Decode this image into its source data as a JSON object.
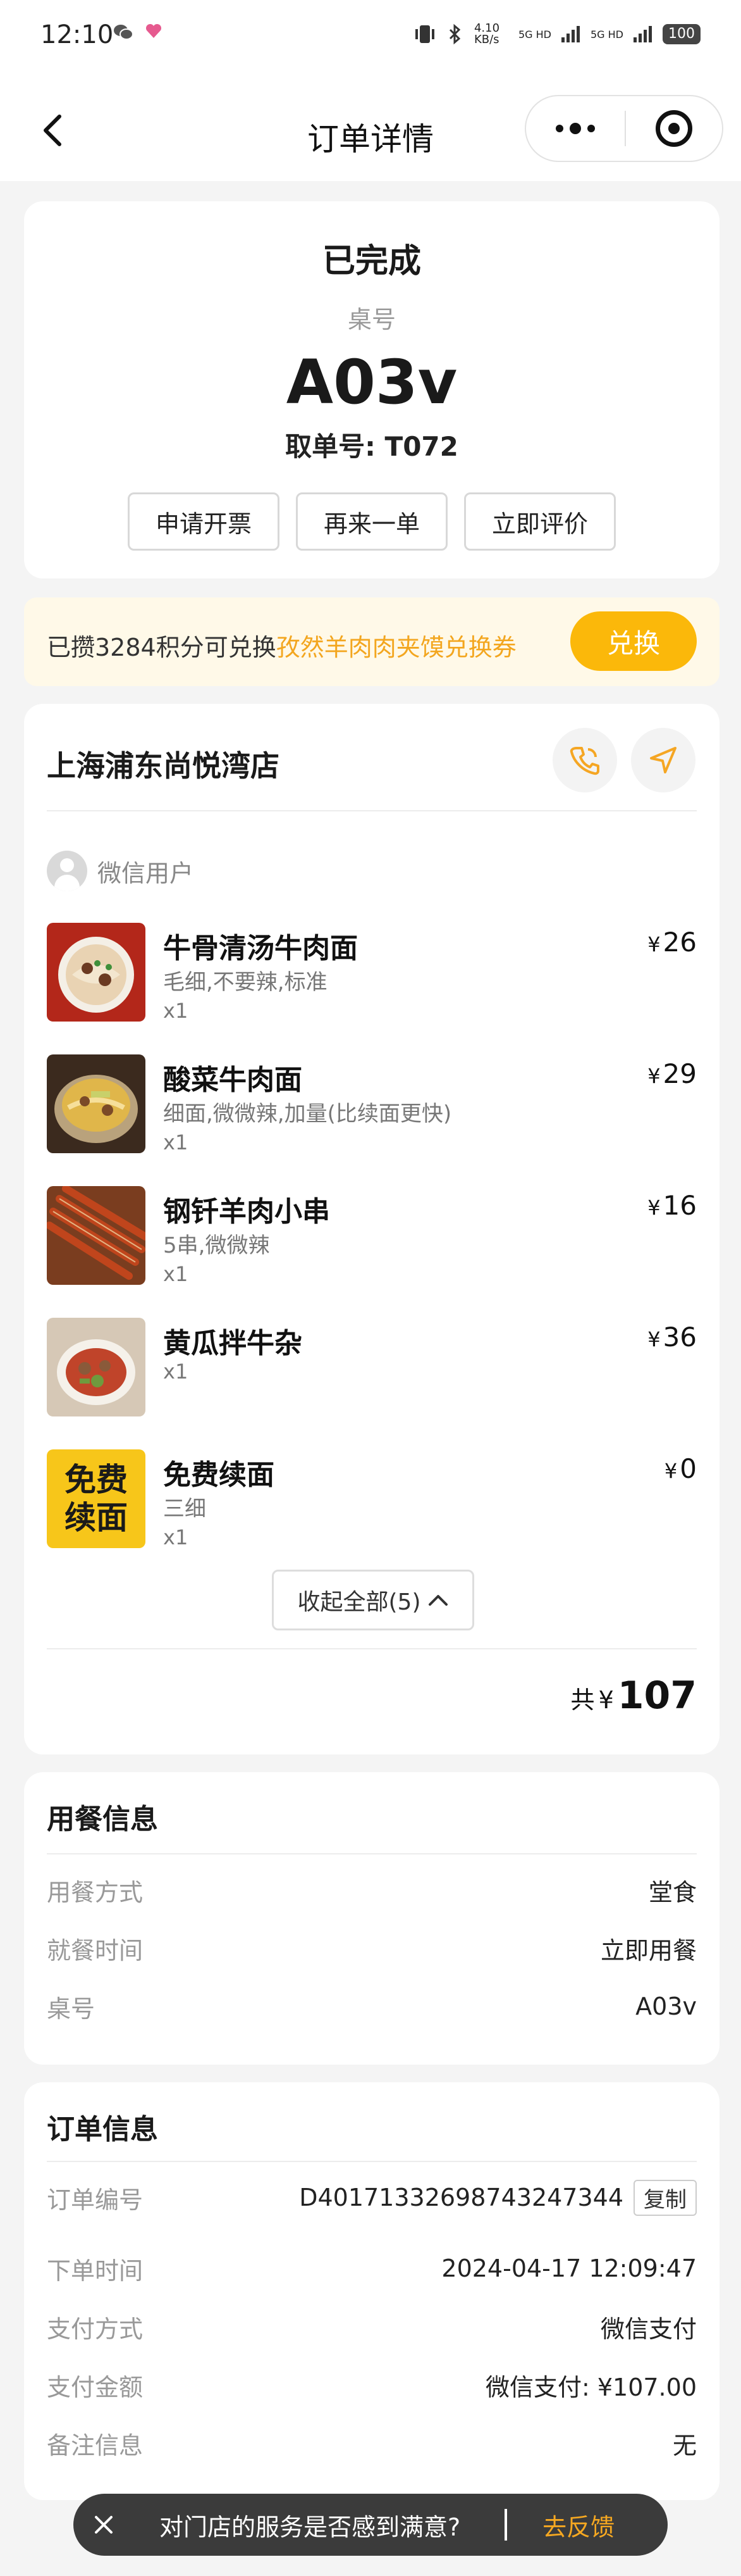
{
  "status_bar": {
    "time": "12:10",
    "net_speed": "4.10 KB/s",
    "signal1": "5G HD",
    "signal2": "5G HD",
    "battery": "100"
  },
  "nav": {
    "title": "订单详情"
  },
  "order_status": {
    "status": "已完成",
    "table_label": "桌号",
    "table_no": "A03v",
    "pickup_no": "取单号: T072",
    "actions": [
      "申请开票",
      "再来一单",
      "立即评价"
    ]
  },
  "points": {
    "prefix": "已攒3284积分可兑换",
    "coupon": "孜然羊肉肉夹馍兑换券",
    "button": "兑换"
  },
  "store": {
    "name": "上海浦东尚悦湾店",
    "user": "微信用户",
    "items": [
      {
        "name": "牛骨清汤牛肉面",
        "spec": "毛细,不要辣,标准",
        "qty": "x1",
        "currency": "¥",
        "price": "26",
        "image": "beef-noodle-soup"
      },
      {
        "name": "酸菜牛肉面",
        "spec": "细面,微微辣,加量(比续面更快)",
        "qty": "x1",
        "currency": "¥",
        "price": "29",
        "image": "pickled-beef-noodle"
      },
      {
        "name": "钢钎羊肉小串",
        "spec": "5串,微微辣",
        "qty": "x1",
        "currency": "¥",
        "price": "16",
        "image": "lamb-skewers"
      },
      {
        "name": "黄瓜拌牛杂",
        "spec": "",
        "qty": "x1",
        "currency": "¥",
        "price": "36",
        "image": "cucumber-beef-offal"
      },
      {
        "name": "免费续面",
        "spec": "三细",
        "qty": "x1",
        "currency": "¥",
        "price": "0",
        "image": "free-refill-noodle",
        "image_text": [
          "免费",
          "续面"
        ]
      }
    ],
    "collapse_label": "收起全部(5)",
    "total_label": "共",
    "total_currency": "¥",
    "total_amount": "107"
  },
  "dining_info": {
    "title": "用餐信息",
    "rows": [
      {
        "label": "用餐方式",
        "value": "堂食"
      },
      {
        "label": "就餐时间",
        "value": "立即用餐"
      },
      {
        "label": "桌号",
        "value": "A03v"
      }
    ]
  },
  "order_info": {
    "title": "订单信息",
    "copy_label": "复制",
    "rows": [
      {
        "label": "订单编号",
        "value": "D40171332698743247344"
      },
      {
        "label": "下单时间",
        "value": "2024-04-17 12:09:47"
      },
      {
        "label": "支付方式",
        "value": "微信支付"
      },
      {
        "label": "支付金额",
        "value": "微信支付: ¥107.00"
      },
      {
        "label": "备注信息",
        "value": "无"
      }
    ]
  },
  "feedback": {
    "text": "对门店的服务是否感到满意?",
    "link": "去反馈"
  },
  "colors": {
    "accent": "#fbb80a",
    "highlight": "#f3a61f",
    "feedback_bg": "#3b3b3b"
  }
}
